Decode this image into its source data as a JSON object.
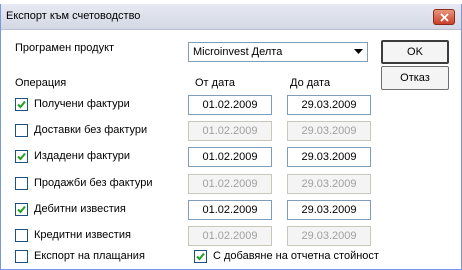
{
  "window": {
    "title": "Експорт към счетоводство"
  },
  "product": {
    "label": "Програмен продукт",
    "selected": "Microinvest Делта"
  },
  "buttons": {
    "ok": "OK",
    "cancel": "Отказ"
  },
  "headers": {
    "operation": "Операция",
    "from_date": "От дата",
    "to_date": "До дата"
  },
  "operations": [
    {
      "label": "Получени фактури",
      "checked": true,
      "from": "01.02.2009",
      "to": "29.03.2009",
      "enabled": true
    },
    {
      "label": "Доставки без фактури",
      "checked": false,
      "from": "01.02.2009",
      "to": "29.03.2009",
      "enabled": false
    },
    {
      "label": "Издадени фактури",
      "checked": true,
      "from": "01.02.2009",
      "to": "29.03.2009",
      "enabled": true
    },
    {
      "label": "Продажби без фактури",
      "checked": false,
      "from": "01.02.2009",
      "to": "29.03.2009",
      "enabled": false
    },
    {
      "label": "Дебитни известия",
      "checked": true,
      "from": "01.02.2009",
      "to": "29.03.2009",
      "enabled": true
    },
    {
      "label": "Кредитни известия",
      "checked": false,
      "from": "01.02.2009",
      "to": "29.03.2009",
      "enabled": false
    }
  ],
  "export_payments": {
    "label": "Експорт на плащания",
    "checked": false
  },
  "add_report_value": {
    "label": "С добавяне на отчетна стойност",
    "checked": true
  }
}
